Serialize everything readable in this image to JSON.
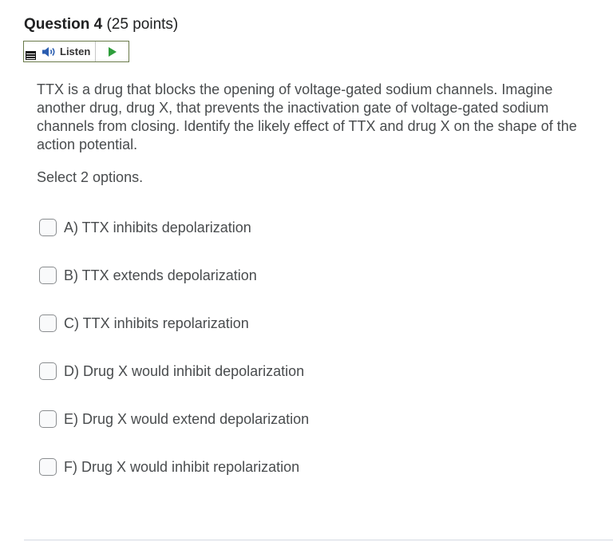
{
  "question": {
    "title": "Question 4",
    "points": "(25 points)"
  },
  "listen": {
    "label": "Listen",
    "menu_icon": "menu-icon",
    "speaker_icon": "speaker-icon",
    "play_icon": "play-icon",
    "play_color": "#2e9e3b"
  },
  "body": {
    "text": "TTX is a drug that blocks the opening of voltage-gated sodium channels. Imagine another drug, drug X, that prevents the inactivation gate of voltage-gated sodium channels from closing. Identify the likely effect of TTX and drug X on the shape of the action potential.",
    "instruction": "Select 2 options."
  },
  "options": [
    {
      "label": "A) TTX inhibits depolarization",
      "checked": false
    },
    {
      "label": "B) TTX extends depolarization",
      "checked": false
    },
    {
      "label": "C) TTX inhibits repolarization",
      "checked": false
    },
    {
      "label": "D) Drug X would inhibit depolarization",
      "checked": false
    },
    {
      "label": "E) Drug X would extend depolarization",
      "checked": false
    },
    {
      "label": "F) Drug X would inhibit repolarization",
      "checked": false
    }
  ]
}
